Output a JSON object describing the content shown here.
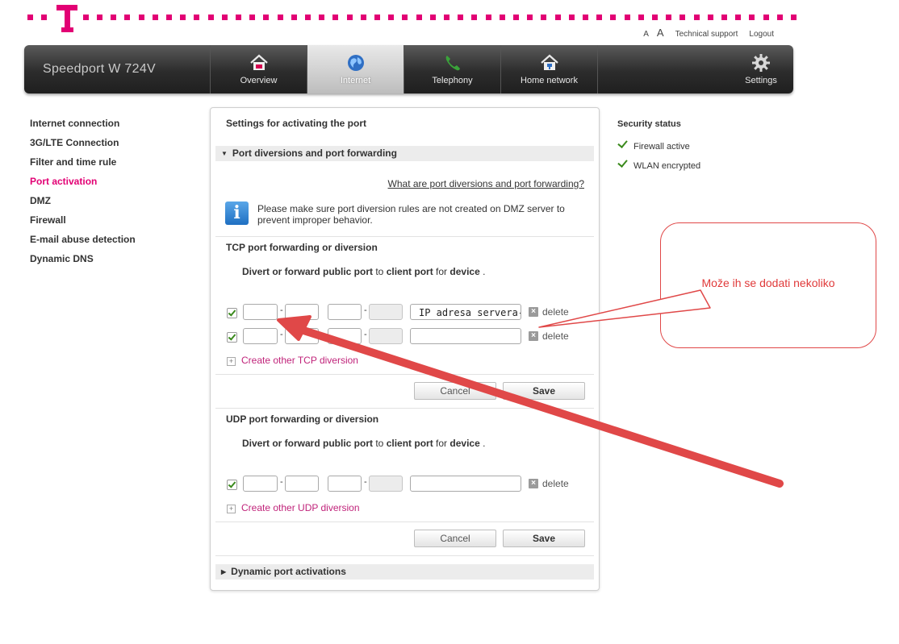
{
  "header": {
    "font_small": "A",
    "font_large": "A",
    "technical_support": "Technical support",
    "logout": "Logout"
  },
  "nav": {
    "brand": "Speedport W 724V",
    "tabs": [
      {
        "label": "Overview",
        "icon": "house-icon"
      },
      {
        "label": "Internet",
        "icon": "globe-icon",
        "active": true
      },
      {
        "label": "Telephony",
        "icon": "phone-icon"
      },
      {
        "label": "Home network",
        "icon": "home-network-icon"
      },
      {
        "label": "Settings",
        "icon": "gear-icon"
      }
    ]
  },
  "sidebar": {
    "items": [
      {
        "label": "Internet connection"
      },
      {
        "label": "3G/LTE Connection"
      },
      {
        "label": "Filter and time rule"
      },
      {
        "label": "Port activation",
        "selected": true
      },
      {
        "label": "DMZ"
      },
      {
        "label": "Firewall"
      },
      {
        "label": "E-mail abuse detection"
      },
      {
        "label": "Dynamic DNS"
      }
    ]
  },
  "main": {
    "title": "Settings for activating the port",
    "section_port_diversions": "Port diversions and port forwarding",
    "help_link": "What are port diversions and port forwarding?",
    "info_text": "Please make sure port diversion rules are not created on DMZ server to prevent improper behavior.",
    "tcp": {
      "heading": "TCP port forwarding or diversion",
      "divert_text": {
        "p1": "Divert or forward public port",
        "p2": " to ",
        "p3": "client port",
        "p4": " for ",
        "p5": "device",
        "p6": " ."
      },
      "rows": [
        {
          "checked": true,
          "public_from": "",
          "public_to": "",
          "client_from": "",
          "client_to": "",
          "device": "IP adresa servera-"
        },
        {
          "checked": true,
          "public_from": "",
          "public_to": "",
          "client_from": "",
          "client_to": "",
          "device": ""
        }
      ],
      "delete_label": "delete",
      "create_link": "Create other TCP diversion",
      "cancel": "Cancel",
      "save": "Save"
    },
    "udp": {
      "heading": "UDP port forwarding or diversion",
      "divert_text": {
        "p1": "Divert or forward public port",
        "p2": " to ",
        "p3": "client port",
        "p4": " for ",
        "p5": "device",
        "p6": " ."
      },
      "rows": [
        {
          "checked": true,
          "public_from": "",
          "public_to": "",
          "client_from": "",
          "client_to": "",
          "device": ""
        }
      ],
      "delete_label": "delete",
      "create_link": "Create other UDP diversion",
      "cancel": "Cancel",
      "save": "Save"
    },
    "section_dynamic": "Dynamic port activations"
  },
  "security": {
    "title": "Security status",
    "items": [
      "Firewall active",
      "WLAN encrypted"
    ]
  },
  "annotation": {
    "callout_text": "Može ih se dodati nekoliko",
    "color": "#e04848"
  },
  "colors": {
    "brand": "#e20074",
    "nav_dark": "#2c2c2c",
    "link": "#c0237a"
  }
}
